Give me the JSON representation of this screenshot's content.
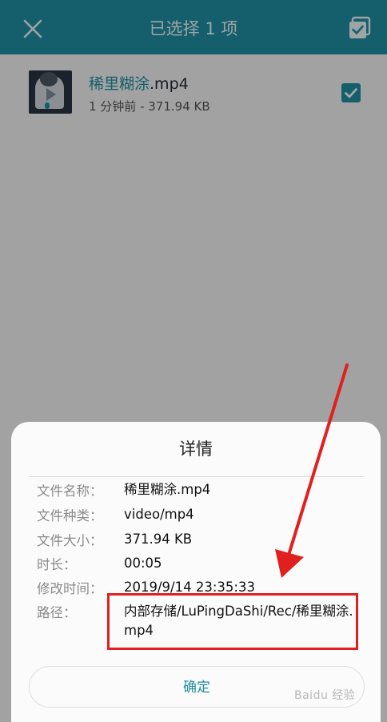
{
  "topbar": {
    "title": "已选择 1 项",
    "close_icon": "close-icon",
    "select_all_icon": "select-all-checkbox-icon",
    "color": "#1e8ea0"
  },
  "file": {
    "name_hl": "稀里糊涂",
    "name_ext": ".mp4",
    "meta": "1 分钟前 - 371.94 KB",
    "checked": true
  },
  "dialog": {
    "title": "详情",
    "props": [
      {
        "label": "文件名称：",
        "value": "稀里糊涂.mp4"
      },
      {
        "label": "文件种类：",
        "value": "video/mp4"
      },
      {
        "label": "文件大小：",
        "value": "371.94 KB"
      },
      {
        "label": "时长：",
        "value": "00:05"
      },
      {
        "label": "修改时间：",
        "value": "2019/9/14 23:35:33"
      },
      {
        "label": "路径：",
        "value": "内部存储/LuPingDaShi/Rec/稀里糊涂.mp4"
      }
    ],
    "ok_label": "确定"
  },
  "annotation": {
    "arrow_color": "#e0201f",
    "box_color": "#e0201f"
  },
  "watermark": "Baidu 经验"
}
